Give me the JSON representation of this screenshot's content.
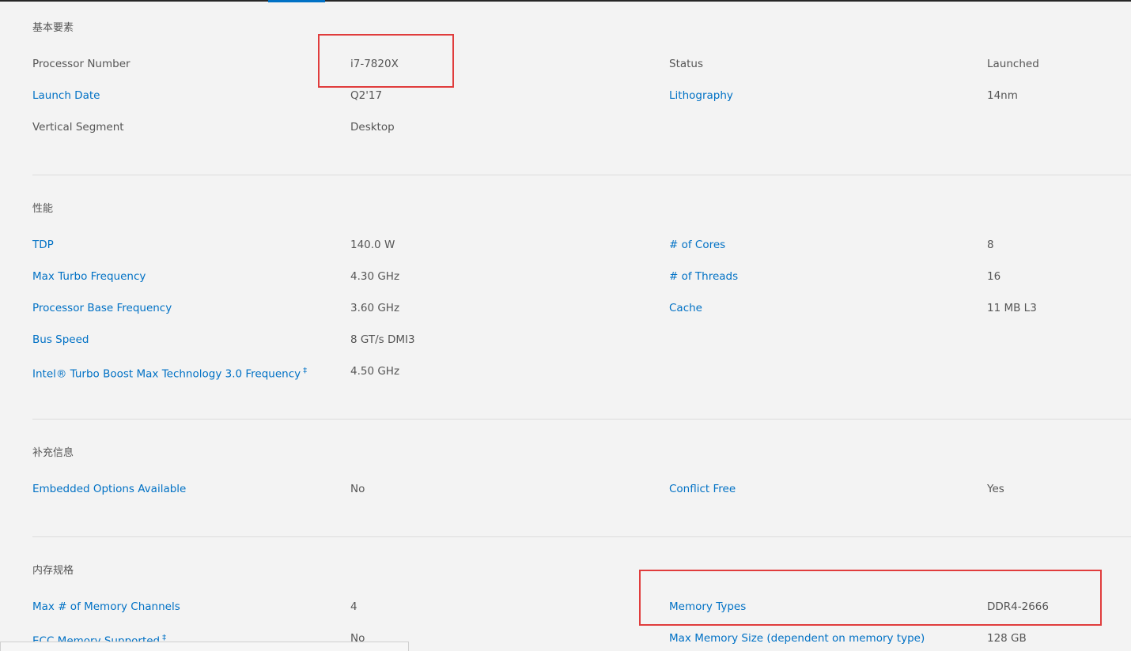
{
  "sections": {
    "essentials": {
      "title": "基本要素",
      "processor_number": {
        "label": "Processor Number",
        "value": "i7-7820X"
      },
      "status": {
        "label": "Status",
        "value": "Launched"
      },
      "launch_date": {
        "label": "Launch Date",
        "value": "Q2'17"
      },
      "lithography": {
        "label": "Lithography",
        "value": "14nm"
      },
      "vertical_segment": {
        "label": "Vertical Segment",
        "value": "Desktop"
      }
    },
    "performance": {
      "title": "性能",
      "tdp": {
        "label": "TDP",
        "value": "140.0 W"
      },
      "cores": {
        "label": "# of Cores",
        "value": "8"
      },
      "max_turbo": {
        "label": "Max Turbo Frequency",
        "value": "4.30 GHz"
      },
      "threads": {
        "label": "# of Threads",
        "value": "16"
      },
      "base_freq": {
        "label": "Processor Base Frequency",
        "value": "3.60 GHz"
      },
      "cache": {
        "label": "Cache",
        "value": "11 MB L3"
      },
      "bus_speed": {
        "label": "Bus Speed",
        "value": "8 GT/s DMI3"
      },
      "turbo_boost_max": {
        "label": "Intel® Turbo Boost Max Technology 3.0 Frequency",
        "footnote": "‡",
        "value": "4.50 GHz"
      }
    },
    "supplemental": {
      "title": "补充信息",
      "embedded": {
        "label": "Embedded Options Available",
        "value": "No"
      },
      "conflict_free": {
        "label": "Conflict Free",
        "value": "Yes"
      }
    },
    "memory": {
      "title": "内存规格",
      "channels": {
        "label": "Max # of Memory Channels",
        "value": "4"
      },
      "types": {
        "label": "Memory Types",
        "value": "DDR4-2666"
      },
      "ecc": {
        "label": "ECC Memory Supported",
        "footnote": "‡",
        "value": "No"
      },
      "max_size": {
        "label": "Max Memory Size (dependent on memory type)",
        "value": "128 GB"
      }
    }
  },
  "colors": {
    "link": "#0071c5",
    "text": "#555555",
    "background": "#f3f3f3",
    "highlight": "#e03c3c"
  }
}
